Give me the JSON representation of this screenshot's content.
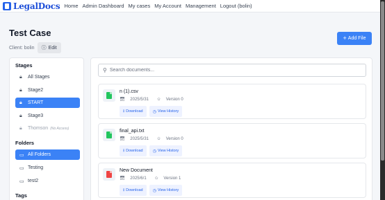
{
  "navbar": {
    "brand": "LegalDocs",
    "links": [
      "Home",
      "Admin Dashboard",
      "My cases",
      "My Account",
      "Management",
      "Logout (bolin)"
    ]
  },
  "page": {
    "title": "Test Case",
    "client": "Client: bolin",
    "edit_label": "Edit",
    "add_file_label": "Add File"
  },
  "sidebar": {
    "stages_title": "Stages",
    "stages": [
      {
        "label": "All Stages",
        "icon": "lock-icon",
        "state": "normal"
      },
      {
        "label": "Stage2",
        "icon": "lock-icon",
        "state": "normal"
      },
      {
        "label": "START",
        "icon": "lock-icon",
        "state": "active"
      },
      {
        "label": "Stage3",
        "icon": "lock-icon",
        "state": "normal"
      },
      {
        "label": "Thomson",
        "icon": "lock-icon",
        "state": "disabled",
        "note": "(No Access)"
      }
    ],
    "folders_title": "Folders",
    "folders": [
      {
        "label": "All Folders",
        "icon": "folder-icon",
        "state": "active"
      },
      {
        "label": "Testing",
        "icon": "folder-icon",
        "state": "normal"
      },
      {
        "label": "test2",
        "icon": "folder-icon",
        "state": "normal"
      }
    ],
    "tags_title": "Tags"
  },
  "search": {
    "placeholder": "Search documents..."
  },
  "documents": [
    {
      "name": "n (1).csv",
      "date": "2025/5/31",
      "version": "Version 0",
      "file_color": "#22c55e"
    },
    {
      "name": "final_api.txt",
      "date": "2025/5/31",
      "version": "Version 0",
      "file_color": "#22c55e"
    },
    {
      "name": "New Document",
      "date": "2025/6/1",
      "version": "Version 1",
      "file_color": "#ef4444"
    }
  ],
  "doc_actions": {
    "download": "Download",
    "history": "View History"
  },
  "colors": {
    "accent": "#3b82f6",
    "brand": "#1d4ed8"
  }
}
